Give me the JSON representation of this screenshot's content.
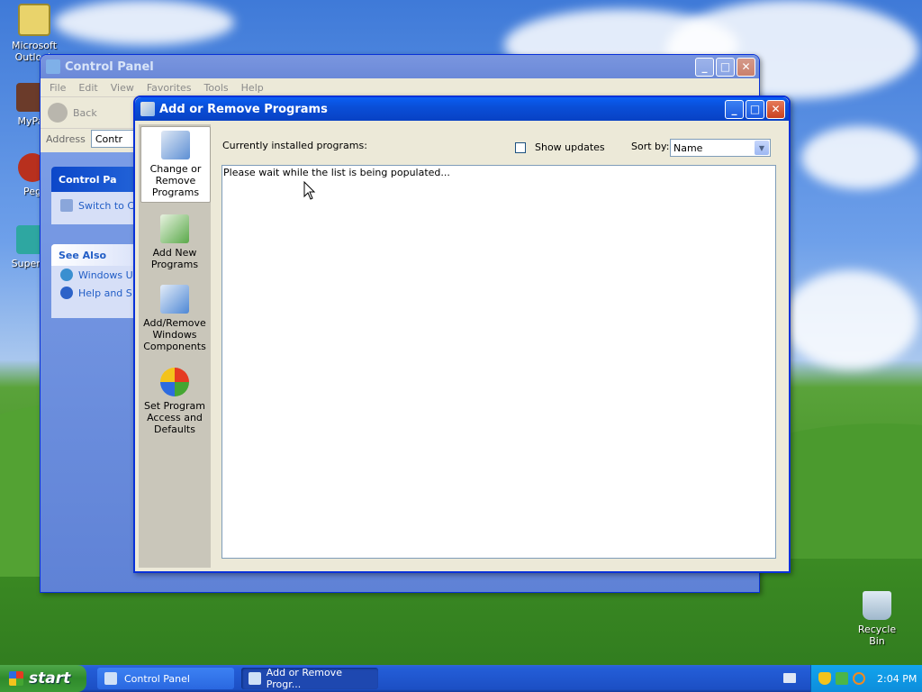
{
  "desktop": {
    "icons": [
      {
        "label": "Microsoft Outlook"
      },
      {
        "label": "MyPa"
      },
      {
        "label": "Peg"
      },
      {
        "label": "Superm"
      },
      {
        "label": "Recycle Bin"
      }
    ]
  },
  "control_panel": {
    "title": "Control Panel",
    "menu": [
      "File",
      "Edit",
      "View",
      "Favorites",
      "Tools",
      "Help"
    ],
    "back_label": "Back",
    "address_label": "Address",
    "address_value": "Contr",
    "task_panel": {
      "title": "Control Pa",
      "link": "Switch to C"
    },
    "see_also": {
      "title": "See Also",
      "links": [
        "Windows U",
        "Help and S"
      ]
    }
  },
  "arp": {
    "title": "Add or Remove Programs",
    "sidebar": [
      "Change or Remove Programs",
      "Add New Programs",
      "Add/Remove Windows Components",
      "Set Program Access and Defaults"
    ],
    "installed_label": "Currently installed programs:",
    "show_updates_label": "Show updates",
    "show_updates_checked": false,
    "sort_by_label": "Sort by:",
    "sort_by_value": "Name",
    "status_text": "Please wait while the list is being populated..."
  },
  "taskbar": {
    "start_label": "start",
    "tasks": [
      "Control Panel",
      "Add or Remove Progr..."
    ],
    "clock": "2:04 PM"
  },
  "colors": {
    "title_active": "#0a4fd8",
    "taskbar": "#245ed8",
    "tray": "#0d8ddb",
    "start": "#2f8a2b"
  }
}
